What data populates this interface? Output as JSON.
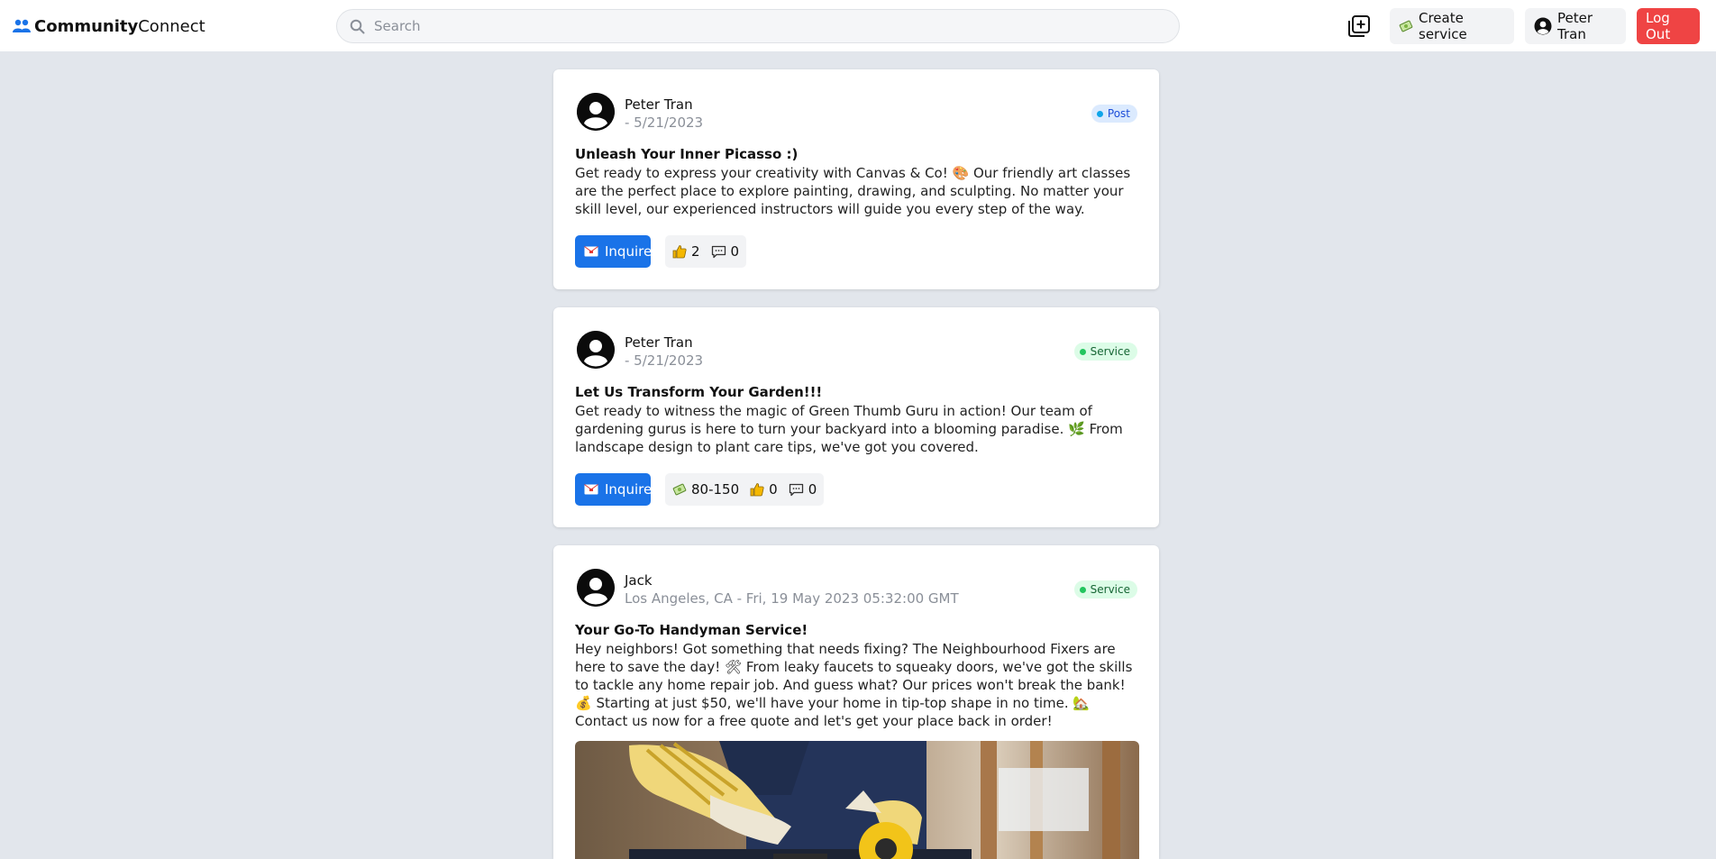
{
  "header": {
    "brand_bold": "Community",
    "brand_rest": "Connect",
    "search_placeholder": "Search",
    "create_service_label": "Create service",
    "user_name": "Peter Tran",
    "logout_label": "Log Out"
  },
  "posts": [
    {
      "author": "Peter Tran",
      "meta": "- 5/21/2023",
      "badge": "Post",
      "title": "Unleash Your Inner Picasso :)",
      "body": "Get ready to express your creativity with Canvas & Co! 🎨 Our friendly art classes are the perfect place to explore painting, drawing, and sculpting. No matter your skill level, our experienced instructors will guide you every step of the way.",
      "inquire_label": "Inquire",
      "likes": "2",
      "comments": "0"
    },
    {
      "author": "Peter Tran",
      "meta": "- 5/21/2023",
      "badge": "Service",
      "title": "Let Us Transform Your Garden!!!",
      "body": "Get ready to witness the magic of Green Thumb Guru in action! Our team of gardening gurus is here to turn your backyard into a blooming paradise. 🌿 From landscape design to plant care tips, we've got you covered.",
      "inquire_label": "Inquire",
      "price": "80-150",
      "likes": "0",
      "comments": "0"
    },
    {
      "author": "Jack",
      "meta": "Los Angeles, CA - Fri, 19 May 2023 05:32:00 GMT",
      "badge": "Service",
      "title": "Your Go-To Handyman Service!",
      "body": "Hey neighbors! Got something that needs fixing? The Neighbourhood Fixers are here to save the day! 🛠 From leaky faucets to squeaky doors, we've got the skills to tackle any home repair job. And guess what? Our prices won't break the bank! 💰 Starting at just $50, we'll have your home in tip-top shape in no time. 🏡 Contact us now for a free quote and let's get your place back in order!"
    }
  ],
  "icons": {
    "brand": "people-icon",
    "search": "search-icon",
    "add": "add-post-icon",
    "create_service": "money-icon",
    "user": "user-circle-icon",
    "inquire": "envelope-icon",
    "like": "thumbs-up-icon",
    "comment": "comment-icon",
    "price": "money-icon"
  },
  "colors": {
    "accent": "#1a73e8",
    "logout": "#ef4444",
    "background": "#e2e6ec"
  }
}
